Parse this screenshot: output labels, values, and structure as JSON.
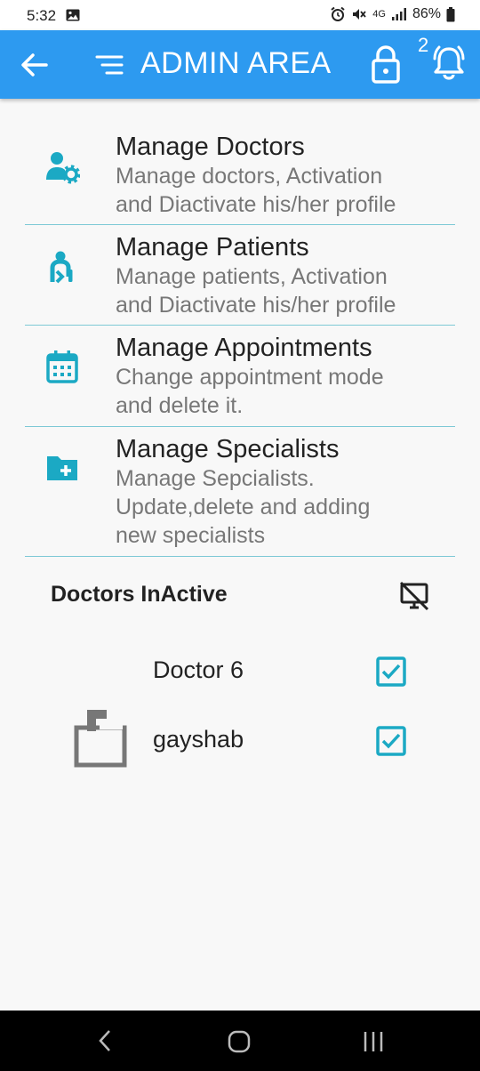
{
  "status_bar": {
    "time": "5:32",
    "battery": "86%",
    "network": "4G"
  },
  "app_bar": {
    "title": "ADMIN AREA",
    "notification_count": "2",
    "color": "#2d9af0"
  },
  "menu": {
    "items": [
      {
        "title": "Manage Doctors",
        "description_line1": "Manage doctors, Activation",
        "description_line2": "and Diactivate his/her profile",
        "icon": "doctor-settings-icon"
      },
      {
        "title": "Manage Patients",
        "description_line1": "Manage patients, Activation",
        "description_line2": "and Diactivate his/her profile",
        "icon": "patient-icon"
      },
      {
        "title": "Manage Appointments",
        "description_line1": "Change appointment mode",
        "description_line2": "and delete it.",
        "icon": "calendar-icon"
      },
      {
        "title": "Manage Specialists",
        "description_line1": "Manage Sepcialists.",
        "description_line2": "Update,delete and adding",
        "description_line3": "new specialists",
        "icon": "folder-add-icon"
      }
    ],
    "accent_color": "#1ba9c4"
  },
  "inactive": {
    "title": "Doctors InActive",
    "doctors": [
      {
        "name": "Doctor 6",
        "checked": true
      },
      {
        "name": "gayshab",
        "checked": true
      }
    ]
  }
}
